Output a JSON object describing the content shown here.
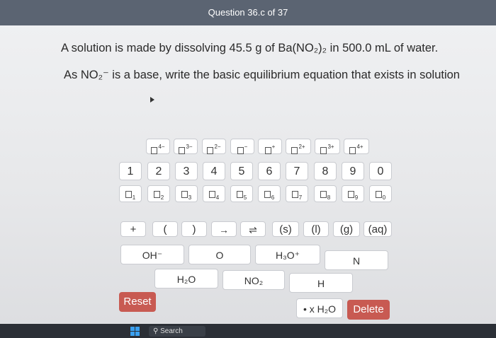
{
  "header": {
    "title": "Question 36.c of 37"
  },
  "question": {
    "line1": "A solution is made by dissolving 45.5 g of Ba(NO₂)₂ in 500.0 mL of water.",
    "line2": "As NO₂⁻ is a base, write the basic equilibrium equation that exists in solution"
  },
  "keypad": {
    "charge_keys": [
      "4−",
      "3−",
      "2−",
      "−",
      "+",
      "2+",
      "3+",
      "4+"
    ],
    "number_keys": [
      "1",
      "2",
      "3",
      "4",
      "5",
      "6",
      "7",
      "8",
      "9",
      "0"
    ],
    "subscript_keys": [
      "1",
      "2",
      "3",
      "4",
      "5",
      "6",
      "7",
      "8",
      "9",
      "0"
    ],
    "symbol_keys": [
      "+",
      "(",
      ")",
      "→",
      "⇌",
      "(s)",
      "(l)",
      "(g)",
      "(aq)"
    ],
    "species_row1": [
      "OH⁻",
      "O",
      "H₃O⁺",
      "N"
    ],
    "species_row2": [
      "H₂O",
      "NO₂",
      "H"
    ],
    "reset": "Reset",
    "water": "• x H₂O",
    "delete": "Delete"
  },
  "taskbar": {
    "search": "Search"
  }
}
